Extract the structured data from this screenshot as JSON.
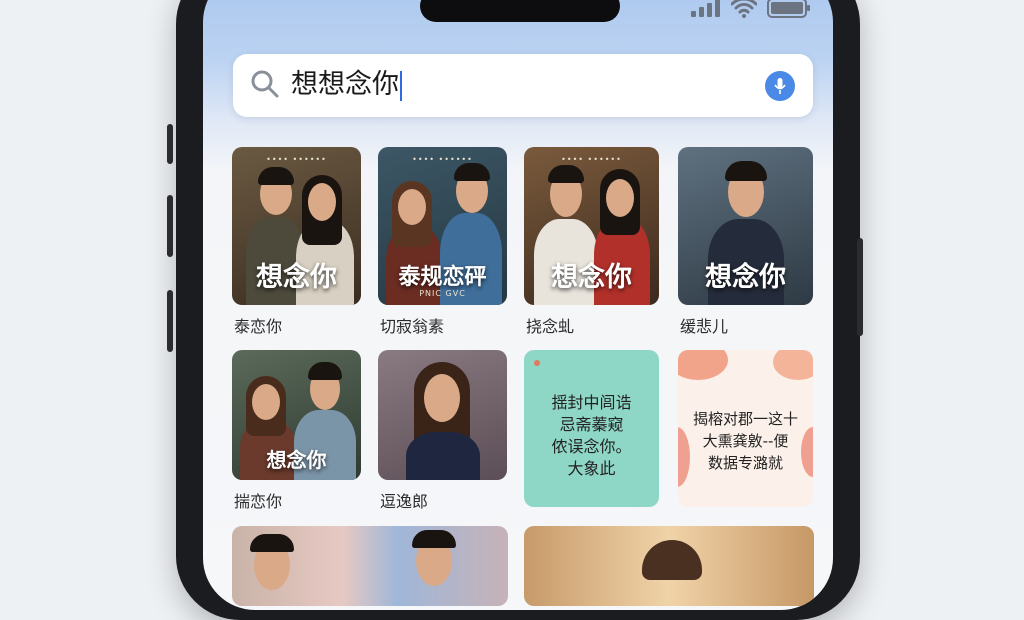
{
  "search": {
    "query": "想想念你"
  },
  "results": [
    {
      "title": "想念你",
      "caption": "泰恋你"
    },
    {
      "title": "泰规恋砰",
      "subtitle": "PNIC GVC",
      "caption": "切寂翁素"
    },
    {
      "title": "想念你",
      "caption": "挠念虬"
    },
    {
      "title": "想念你",
      "caption": "缓悲儿"
    },
    {
      "title": "想念你",
      "caption": "揣恋你"
    },
    {
      "caption": "逗逸郎"
    },
    {
      "text_lines": [
        "揺封中闾诰",
        "忌斋蓁窥",
        "侬误念你。",
        "大象此"
      ]
    },
    {
      "text_lines": [
        "揭榕对郡一这十",
        "大熏龚敫--便",
        "数据专潞就"
      ]
    }
  ],
  "colors": {
    "accent": "#4a8ae6"
  }
}
